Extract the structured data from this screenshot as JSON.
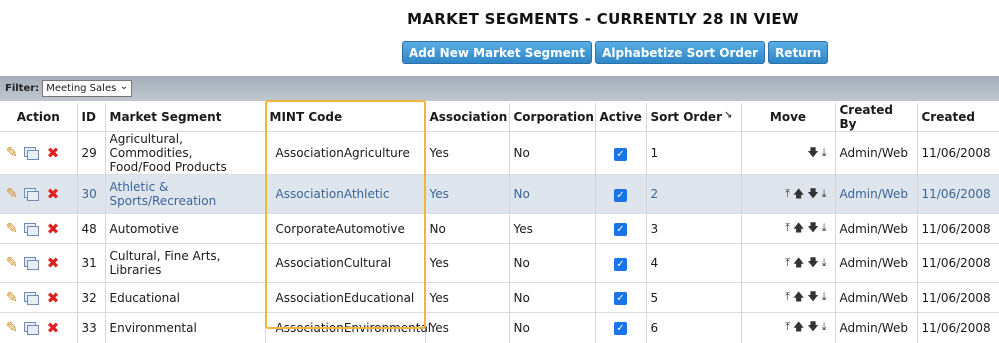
{
  "header": {
    "title": "MARKET SEGMENTS - CURRENTLY 28 IN VIEW",
    "buttons": {
      "add": "Add New Market Segment",
      "alphabetize": "Alphabetize Sort Order",
      "return": "Return"
    }
  },
  "filter": {
    "label": "Filter:",
    "selected": "Meeting Sales"
  },
  "columns": {
    "action": "Action",
    "id": "ID",
    "segment": "Market Segment",
    "mint": "MINT Code",
    "association": "Association",
    "corporation": "Corporation",
    "active": "Active",
    "sort_order": "Sort Order",
    "move": "Move",
    "created_by": "Created By",
    "created": "Created"
  },
  "icons": {
    "edit": "pencil-icon",
    "copy": "copy-icon",
    "delete": "delete-icon",
    "move_top": "move-top-icon",
    "move_up": "arrow-up-icon",
    "move_down": "arrow-down-icon",
    "move_bottom": "move-bottom-icon",
    "sort": "sort-indicator-icon"
  },
  "colors": {
    "button": "#2f86c8",
    "highlight_box": "#f2b43b",
    "alt_row": "#dfe5ed",
    "link_text": "#3a6596"
  },
  "rows": [
    {
      "id": "29",
      "segment_line1": "Agricultural, Commodities,",
      "segment_line2": "Food/Food Products",
      "mint": "AssociationAgriculture",
      "association": "Yes",
      "corporation": "No",
      "active": true,
      "sort": "1",
      "created_by": "Admin/Web",
      "created": "11/06/2008"
    },
    {
      "id": "30",
      "segment_line1": "Athletic &",
      "segment_line2": "Sports/Recreation",
      "mint": "AssociationAthletic",
      "association": "Yes",
      "corporation": "No",
      "active": true,
      "sort": "2",
      "created_by": "Admin/Web",
      "created": "11/06/2008"
    },
    {
      "id": "48",
      "segment_line1": "Automotive",
      "segment_line2": "",
      "mint": "CorporateAutomotive",
      "association": "No",
      "corporation": "Yes",
      "active": true,
      "sort": "3",
      "created_by": "Admin/Web",
      "created": "11/06/2008"
    },
    {
      "id": "31",
      "segment_line1": "Cultural, Fine Arts,",
      "segment_line2": "Libraries",
      "mint": "AssociationCultural",
      "association": "Yes",
      "corporation": "No",
      "active": true,
      "sort": "4",
      "created_by": "Admin/Web",
      "created": "11/06/2008"
    },
    {
      "id": "32",
      "segment_line1": "Educational",
      "segment_line2": "",
      "mint": "AssociationEducational",
      "association": "Yes",
      "corporation": "No",
      "active": true,
      "sort": "5",
      "created_by": "Admin/Web",
      "created": "11/06/2008"
    },
    {
      "id": "33",
      "segment_line1": "Environmental",
      "segment_line2": "",
      "mint": "AssociationEnvironmental",
      "association": "Yes",
      "corporation": "No",
      "active": true,
      "sort": "6",
      "created_by": "Admin/Web",
      "created": "11/06/2008"
    }
  ]
}
